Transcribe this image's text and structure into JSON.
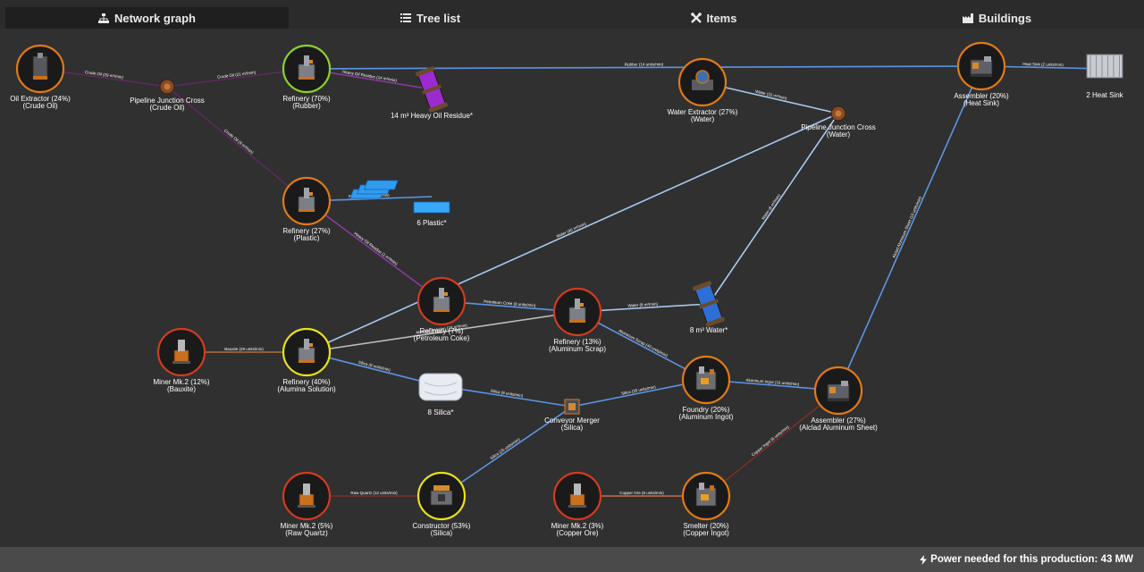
{
  "tabs": [
    {
      "label": "Network graph",
      "icon": "sitemap-icon",
      "active": true
    },
    {
      "label": "Tree list",
      "icon": "list-icon",
      "active": false
    },
    {
      "label": "Items",
      "icon": "tools-icon",
      "active": false
    },
    {
      "label": "Buildings",
      "icon": "buildings-icon",
      "active": false
    }
  ],
  "footer": {
    "icon": "bolt-icon",
    "label": "Power needed for this production:",
    "value": "43 MW"
  },
  "colors": {
    "background": "#303030",
    "edge_solid": "#5b95e5",
    "edge_liquid_oil": "#5c2a5e",
    "edge_liquid_heavy": "#8a3aa0",
    "edge_water": "#a8c8f0",
    "edge_bauxite": "#b36a3a",
    "edge_quartz": "#7a2f2a",
    "edge_copper": "#c96b4a",
    "edge_coke": "#bbbbbb",
    "ring_orange": "#e07a18",
    "ring_red": "#d33b20",
    "ring_green": "#8ed12c",
    "ring_yellow": "#e8e020"
  },
  "nodes": [
    {
      "id": "oil-extractor",
      "line1": "Oil Extractor (24%)",
      "line2": "(Crude Oil)",
      "kind": "building",
      "ring": "orange",
      "icon": "oil-extractor-icon"
    },
    {
      "id": "pj-crude",
      "line1": "Pipeline Junction Cross",
      "line2": "(Crude Oil)",
      "kind": "junction",
      "icon": "pipeline-junction-icon"
    },
    {
      "id": "ref-rubber",
      "line1": "Refinery (70%)",
      "line2": "(Rubber)",
      "kind": "building",
      "ring": "green",
      "icon": "refinery-icon"
    },
    {
      "id": "heavy-oil",
      "line1": "14 m³ Heavy Oil Residue*",
      "line2": "",
      "kind": "item",
      "icon": "heavy-oil-canister-icon"
    },
    {
      "id": "water-ext",
      "line1": "Water Extractor (27%)",
      "line2": "(Water)",
      "kind": "building",
      "ring": "orange",
      "icon": "water-extractor-icon"
    },
    {
      "id": "pj-water",
      "line1": "Pipeline Junction Cross",
      "line2": "(Water)",
      "kind": "junction",
      "icon": "pipeline-junction-icon"
    },
    {
      "id": "asm-heatsink",
      "line1": "Assembler (20%)",
      "line2": "(Heat Sink)",
      "kind": "building",
      "ring": "orange",
      "icon": "assembler-icon"
    },
    {
      "id": "heat-sink",
      "line1": "2 Heat Sink",
      "line2": "",
      "kind": "item",
      "icon": "heat-sink-icon"
    },
    {
      "id": "ref-plastic",
      "line1": "Refinery (27%)",
      "line2": "(Plastic)",
      "kind": "building",
      "ring": "orange",
      "icon": "refinery-icon"
    },
    {
      "id": "plastic",
      "line1": "6 Plastic*",
      "line2": "",
      "kind": "item",
      "icon": "plastic-icon"
    },
    {
      "id": "ref-coke",
      "line1": "Refinery (7%)",
      "line2": "(Petroleum Coke)",
      "kind": "building",
      "ring": "red",
      "icon": "refinery-icon"
    },
    {
      "id": "ref-scrap",
      "line1": "Refinery (13%)",
      "line2": "(Aluminum Scrap)",
      "kind": "building",
      "ring": "red",
      "icon": "refinery-icon"
    },
    {
      "id": "water-item",
      "line1": "8 m³ Water*",
      "line2": "",
      "kind": "item",
      "icon": "water-canister-icon"
    },
    {
      "id": "miner-bauxite",
      "line1": "Miner Mk.2 (12%)",
      "line2": "(Bauxite)",
      "kind": "building",
      "ring": "red",
      "icon": "miner-icon"
    },
    {
      "id": "ref-alsol",
      "line1": "Refinery (40%)",
      "line2": "(Alumina Solution)",
      "kind": "building",
      "ring": "yellow",
      "icon": "refinery-icon"
    },
    {
      "id": "silica",
      "line1": "8 Silica*",
      "line2": "",
      "kind": "item",
      "icon": "silica-icon"
    },
    {
      "id": "merger",
      "line1": "Conveyor Merger",
      "line2": "(Silica)",
      "kind": "junction",
      "icon": "conveyor-merger-icon"
    },
    {
      "id": "foundry",
      "line1": "Foundry (20%)",
      "line2": "(Aluminum Ingot)",
      "kind": "building",
      "ring": "orange",
      "icon": "foundry-icon"
    },
    {
      "id": "asm-sheet",
      "line1": "Assembler (27%)",
      "line2": "(Alclad Aluminum Sheet)",
      "kind": "building",
      "ring": "orange",
      "icon": "assembler-icon"
    },
    {
      "id": "miner-quartz",
      "line1": "Miner Mk.2 (5%)",
      "line2": "(Raw Quartz)",
      "kind": "building",
      "ring": "red",
      "icon": "miner-icon"
    },
    {
      "id": "constructor",
      "line1": "Constructor (53%)",
      "line2": "(Silica)",
      "kind": "building",
      "ring": "yellow",
      "icon": "constructor-icon"
    },
    {
      "id": "miner-copper",
      "line1": "Miner Mk.2 (3%)",
      "line2": "(Copper Ore)",
      "kind": "building",
      "ring": "red",
      "icon": "miner-icon"
    },
    {
      "id": "smelter",
      "line1": "Smelter (20%)",
      "line2": "(Copper Ingot)",
      "kind": "building",
      "ring": "orange",
      "icon": "smelter-icon"
    }
  ],
  "edges": [
    {
      "from": "oil-extractor",
      "to": "pj-crude",
      "label": "Crude Oil (29 m³/min)",
      "type": "oil"
    },
    {
      "from": "pj-crude",
      "to": "ref-rubber",
      "label": "Crude Oil (21 m³/min)",
      "type": "oil"
    },
    {
      "from": "pj-crude",
      "to": "ref-plastic",
      "label": "Crude Oil (8 m³/min)",
      "type": "oil"
    },
    {
      "from": "ref-rubber",
      "to": "heavy-oil",
      "label": "Heavy Oil Residue (14 m³/min)",
      "type": "heavy"
    },
    {
      "from": "ref-rubber",
      "to": "asm-heatsink",
      "label": "Rubber (14 units/min)",
      "type": "solid"
    },
    {
      "from": "asm-heatsink",
      "to": "heat-sink",
      "label": "Heat Sink (2 units/min)",
      "type": "solid"
    },
    {
      "from": "water-ext",
      "to": "pj-water",
      "label": "Water (22 m³/min)",
      "type": "water"
    },
    {
      "from": "ref-plastic",
      "to": "plastic",
      "label": "Plastic (3.33 units/min)",
      "type": "solid"
    },
    {
      "from": "ref-plastic",
      "to": "ref-coke",
      "label": "Heavy Oil Residue (1 m³/min)",
      "type": "heavy"
    },
    {
      "from": "pj-water",
      "to": "ref-alsol",
      "label": "Water (40 m³/min)",
      "type": "water"
    },
    {
      "from": "ref-coke",
      "to": "ref-scrap",
      "label": "Petroleum Coke (8 units/min)",
      "type": "solid"
    },
    {
      "from": "ref-scrap",
      "to": "water-item",
      "label": "Water (8 m³/min)",
      "type": "water"
    },
    {
      "from": "water-item",
      "to": "pj-water",
      "label": "Water (8 m³/min)",
      "type": "water"
    },
    {
      "from": "ref-alsol",
      "to": "ref-scrap",
      "label": "Alumina Solution (24 m³/min)",
      "type": "coke"
    },
    {
      "from": "miner-bauxite",
      "to": "ref-alsol",
      "label": "Bauxite (29 units/min)",
      "type": "bauxite"
    },
    {
      "from": "ref-alsol",
      "to": "silica",
      "label": "Silica (8 units/min)",
      "type": "solid"
    },
    {
      "from": "silica",
      "to": "merger",
      "label": "Silica (8 units/min)",
      "type": "solid"
    },
    {
      "from": "merger",
      "to": "foundry",
      "label": "Silica (25 units/min)",
      "type": "solid"
    },
    {
      "from": "ref-scrap",
      "to": "foundry",
      "label": "Aluminum Scrap (40 units/min)",
      "type": "solid"
    },
    {
      "from": "foundry",
      "to": "asm-sheet",
      "label": "Aluminum Ingot (16 units/min)",
      "type": "solid"
    },
    {
      "from": "asm-sheet",
      "to": "asm-heatsink",
      "label": "Alclad Aluminum Sheet (10 units/min)",
      "type": "solid"
    },
    {
      "from": "miner-quartz",
      "to": "constructor",
      "label": "Raw Quartz (12 units/min)",
      "type": "quartz"
    },
    {
      "from": "constructor",
      "to": "merger",
      "label": "Silica (25 units/min)",
      "type": "solid"
    },
    {
      "from": "miner-copper",
      "to": "smelter",
      "label": "Copper Ore (6 units/min)",
      "type": "copper"
    },
    {
      "from": "smelter",
      "to": "asm-sheet",
      "label": "Copper Ingot (6 units/min)",
      "type": "quartz"
    }
  ]
}
